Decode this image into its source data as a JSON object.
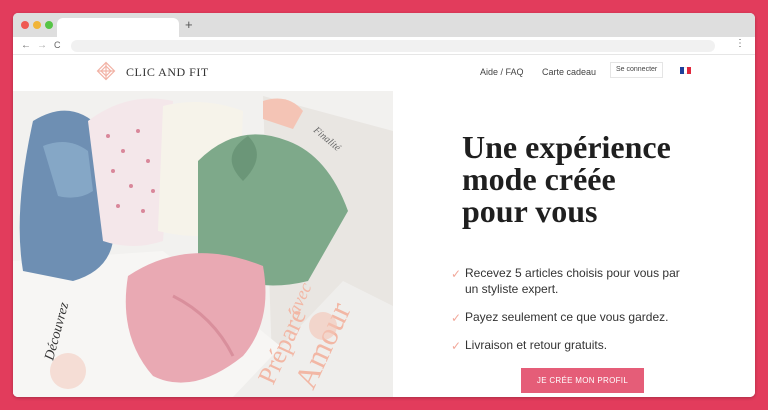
{
  "browser": {
    "new_tab": "+",
    "back": "←",
    "forward": "→",
    "reload": "C",
    "menu": "⋮"
  },
  "header": {
    "brand": "CLIC AND FIT",
    "links": [
      "Aide / FAQ",
      "Carte cadeau"
    ],
    "login": "Se connecter",
    "flag_colors": [
      "#1e3f9a",
      "#ffffff",
      "#e0283c"
    ]
  },
  "hero": {
    "headline_lines": [
      "Une expérience",
      "mode créée",
      "pour vous"
    ],
    "features": [
      "Recevez 5 articles choisis pour vous par un styliste expert.",
      "Payez seulement ce que vous gardez.",
      "Livraison et retour gratuits."
    ],
    "cta": "JE CRÉE MON PROFIL",
    "box_text": [
      "Préparé",
      "avec",
      "Amour",
      "Découvrez",
      "Finalité"
    ]
  },
  "colors": {
    "background": "#e23c5c",
    "accent": "#e55d78",
    "check": "#f2a89a"
  }
}
